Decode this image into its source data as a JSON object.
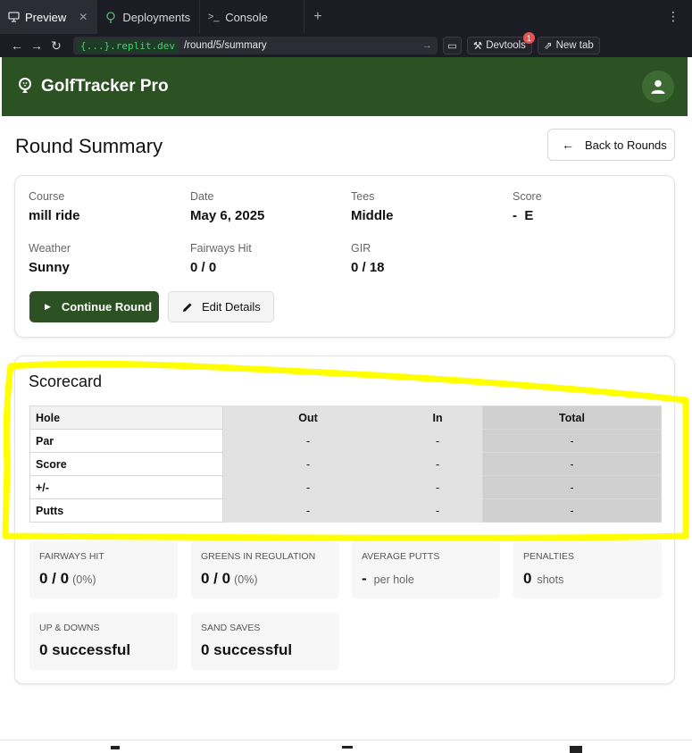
{
  "browser": {
    "tabs": [
      {
        "label": "Preview",
        "icon": "monitor-icon",
        "active": true
      },
      {
        "label": "Deployments",
        "icon": "deploy-icon",
        "active": false
      },
      {
        "label": "Console",
        "icon": "terminal-icon",
        "active": false
      }
    ],
    "url_host": "{...}.replit.dev",
    "url_path": "/round/5/summary",
    "devtools_label": "Devtools",
    "devtools_badge": "1",
    "newtab_label": "New tab"
  },
  "app": {
    "title": "GolfTracker Pro",
    "brand_color": "#2c5223"
  },
  "page": {
    "title": "Round Summary",
    "back_label": "Back to Rounds"
  },
  "details": {
    "course_label": "Course",
    "course": "mill ride",
    "date_label": "Date",
    "date": "May 6, 2025",
    "tees_label": "Tees",
    "tees": "Middle",
    "score_label": "Score",
    "score": "-  E",
    "weather_label": "Weather",
    "weather": "Sunny",
    "fairways_label": "Fairways Hit",
    "fairways": "0 / 0",
    "gir_label": "GIR",
    "gir": "0 / 18",
    "continue_label": "Continue Round",
    "edit_label": "Edit Details"
  },
  "scorecard": {
    "title": "Scorecard",
    "headers": [
      "Hole",
      "Out",
      "In",
      "Total"
    ],
    "rows": [
      {
        "label": "Par",
        "out": "-",
        "in": "-",
        "total": "-"
      },
      {
        "label": "Score",
        "out": "-",
        "in": "-",
        "total": "-"
      },
      {
        "label": "+/-",
        "out": "-",
        "in": "-",
        "total": "-"
      },
      {
        "label": "Putts",
        "out": "-",
        "in": "-",
        "total": "-"
      }
    ]
  },
  "stats": {
    "fairways": {
      "label": "Fairways Hit",
      "value": "0 / 0",
      "sub": "(0%)"
    },
    "gir": {
      "label": "Greens in Regulation",
      "value": "0 / 0",
      "sub": "(0%)"
    },
    "putts": {
      "label": "Average Putts",
      "value": "-",
      "sub": "per hole"
    },
    "penalties": {
      "label": "Penalties",
      "value": "0",
      "sub": "shots"
    },
    "updowns": {
      "label": "Up & Downs",
      "value": "0 successful"
    },
    "sandsaves": {
      "label": "Sand Saves",
      "value": "0 successful"
    }
  },
  "annotation_color": "#ffff00"
}
